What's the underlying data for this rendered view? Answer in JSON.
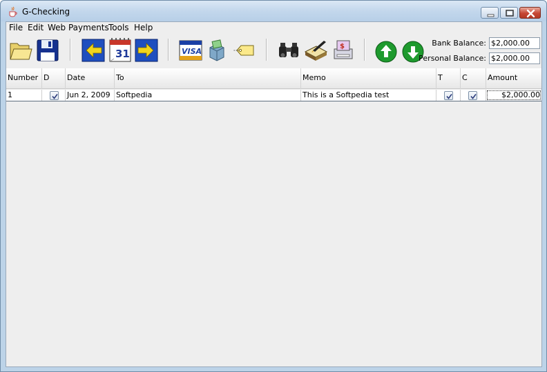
{
  "window": {
    "title": "G-Checking",
    "icon": "java-cup-icon"
  },
  "menu": [
    "File",
    "Edit",
    "Web Payments",
    "Tools",
    "Help"
  ],
  "toolbar": {
    "buttons": [
      "open-folder-icon",
      "save-disk-icon",
      "previous-arrow-icon",
      "calendar-icon",
      "next-arrow-icon",
      "visa-card-icon",
      "deposit-box-icon",
      "tag-icon",
      "binoculars-icon",
      "notebook-pen-icon",
      "printer-check-icon",
      "move-up-icon",
      "move-down-icon"
    ],
    "bank_balance_label": "Bank Balance:",
    "bank_balance_value": "$2,000.00",
    "personal_balance_label": "Personal Balance:",
    "personal_balance_value": "$2,000.00"
  },
  "table": {
    "columns": [
      "Number",
      "D",
      "Date",
      "To",
      "Memo",
      "T",
      "C",
      "Amount"
    ],
    "rows": [
      {
        "number": "1",
        "d": true,
        "date": "Jun 2, 2009",
        "to": "Softpedia",
        "memo": "This is a Softpedia test",
        "t": true,
        "c": true,
        "amount": "$2,000.00"
      }
    ]
  },
  "colors": {
    "titlebar": "#c3d7ec",
    "close_button": "#c64634",
    "arrow_blue": "#1f4fbf",
    "arrow_yellow": "#f2d51c",
    "round_green": "#1e9a2e"
  }
}
